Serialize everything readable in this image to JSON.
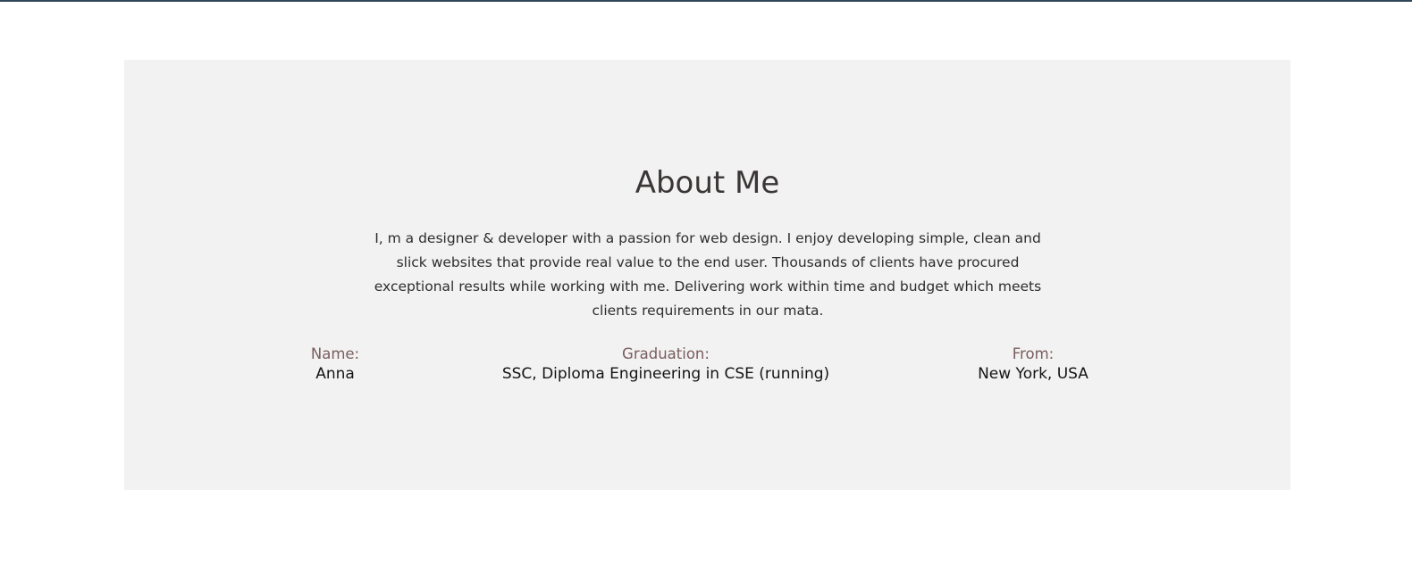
{
  "about": {
    "title": "About Me",
    "description": "I, m a designer & developer with a passion for web design. I enjoy developing simple, clean and slick websites that provide real value to the end user. Thousands of clients have procured exceptional results while working with me. Delivering work within time and budget which meets clients requirements in our mata."
  },
  "info": {
    "name": {
      "label": "Name:",
      "value": "Anna"
    },
    "graduation": {
      "label": "Graduation:",
      "value": "SSC, Diploma Engineering in CSE (running)"
    },
    "from": {
      "label": "From:",
      "value": "New York, USA"
    }
  },
  "colors": {
    "top_border": "#2f4858",
    "section_background": "#f2f2f2",
    "title": "#3b3636",
    "label": "#7a5e5e",
    "value": "#141414"
  }
}
